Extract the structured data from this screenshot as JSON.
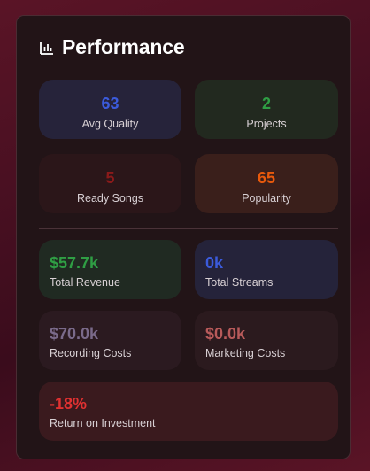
{
  "header": {
    "title": "Performance",
    "icon": "bar-chart-icon"
  },
  "stats": [
    {
      "value": "63",
      "label": "Avg Quality",
      "color": "#3b5bdb"
    },
    {
      "value": "2",
      "label": "Projects",
      "color": "#2f9e44"
    },
    {
      "value": "5",
      "label": "Ready Songs",
      "color": "#8b1a1a"
    },
    {
      "value": "65",
      "label": "Popularity",
      "color": "#e8590c"
    }
  ],
  "finance": [
    {
      "value": "$57.7k",
      "label": "Total Revenue",
      "color": "#2f9e44"
    },
    {
      "value": "0k",
      "label": "Total Streams",
      "color": "#3b5bdb"
    },
    {
      "value": "$70.0k",
      "label": "Recording Costs",
      "color": "#7a6a8a"
    },
    {
      "value": "$0.0k",
      "label": "Marketing Costs",
      "color": "#b85a5a"
    },
    {
      "value": "-18%",
      "label": "Return on Investment",
      "color": "#e03131"
    }
  ]
}
